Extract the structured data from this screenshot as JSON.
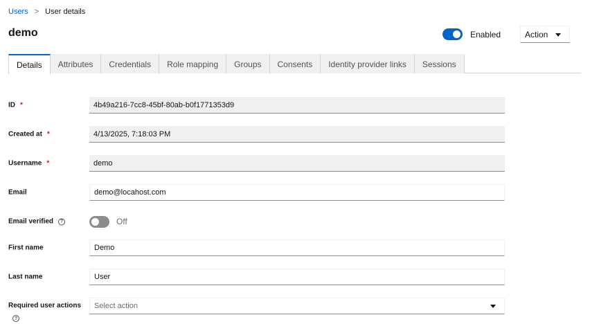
{
  "breadcrumb": {
    "parent": "Users",
    "separator": ">",
    "current": "User details"
  },
  "page_title": "demo",
  "header": {
    "enabled_label": "Enabled",
    "action_label": "Action"
  },
  "tabs": [
    {
      "label": "Details"
    },
    {
      "label": "Attributes"
    },
    {
      "label": "Credentials"
    },
    {
      "label": "Role mapping"
    },
    {
      "label": "Groups"
    },
    {
      "label": "Consents"
    },
    {
      "label": "Identity provider links"
    },
    {
      "label": "Sessions"
    }
  ],
  "form": {
    "id": {
      "label": "ID",
      "value": "4b49a216-7cc8-45bf-80ab-b0f1771353d9"
    },
    "created_at": {
      "label": "Created at",
      "value": "4/13/2025, 7:18:03 PM"
    },
    "username": {
      "label": "Username",
      "value": "demo"
    },
    "email": {
      "label": "Email",
      "value": "demo@locahost.com"
    },
    "email_verified": {
      "label": "Email verified",
      "state_label": "Off"
    },
    "first_name": {
      "label": "First name",
      "value": "Demo"
    },
    "last_name": {
      "label": "Last name",
      "value": "User"
    },
    "required_actions": {
      "label": "Required user actions",
      "placeholder": "Select action"
    }
  },
  "required_marker": "*",
  "help_glyph": "?",
  "colors": {
    "accent": "#0066cc",
    "required": "#c9190b"
  }
}
